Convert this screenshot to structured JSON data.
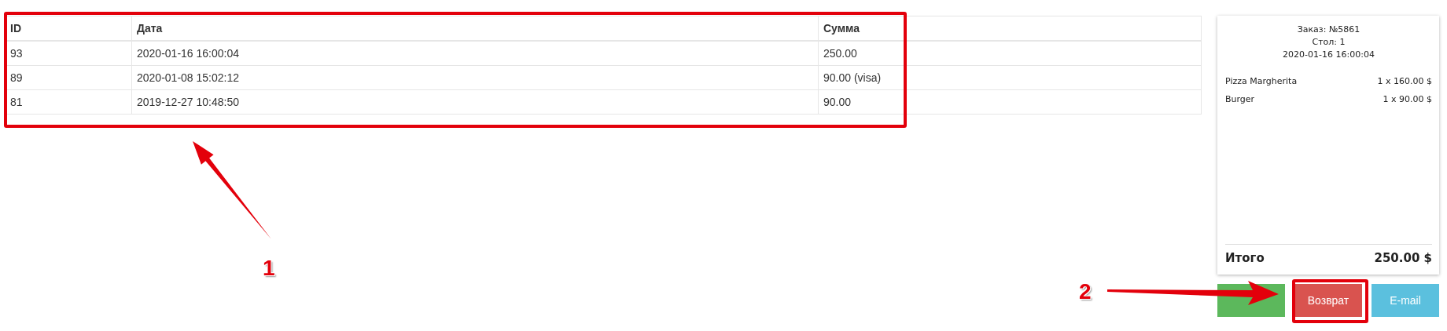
{
  "table": {
    "columns": [
      "ID",
      "Дата",
      "Сумма"
    ],
    "rows": [
      [
        "93",
        "2020-01-16 16:00:04",
        "250.00"
      ],
      [
        "89",
        "2020-01-08 15:02:12",
        "90.00 (visa)"
      ],
      [
        "81",
        "2019-12-27 10:48:50",
        "90.00"
      ]
    ]
  },
  "receipt": {
    "header": [
      "Заказ: №5861",
      "Стол: 1",
      "2020-01-16 16:00:04"
    ],
    "items": [
      {
        "name": "Pizza Margherita",
        "amount": "1 x 160.00 $"
      },
      {
        "name": "Burger",
        "amount": "1 x 90.00 $"
      }
    ],
    "total_label": "Итого",
    "total": "250.00 $"
  },
  "buttons": [
    {
      "kind": "success"
    },
    {
      "kind": "danger",
      "label": "Возврат"
    },
    {
      "kind": "info",
      "label": "E-mail"
    }
  ],
  "annotations": [
    "1",
    "2"
  ]
}
